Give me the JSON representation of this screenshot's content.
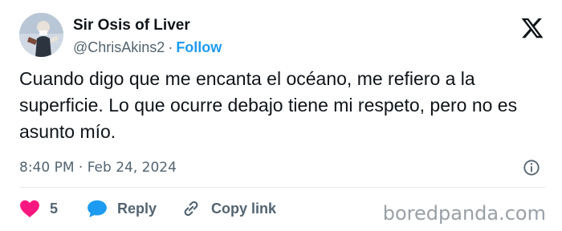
{
  "author": {
    "name": "Sir Osis of Liver",
    "handle": "@ChrisAkins2",
    "separator": "·",
    "follow_label": "Follow",
    "avatar_icon": "profile-avatar"
  },
  "platform": {
    "logo_icon": "x-logo-icon"
  },
  "tweet": {
    "text": "Cuando digo que me encanta el océano, me refiero a la superficie. Lo que ocurre debajo tiene mi respeto, pero no es asunto mío.",
    "timestamp": "8:40 PM · Feb 24, 2024"
  },
  "actions": {
    "like_count": "5",
    "reply_label": "Reply",
    "copy_link_label": "Copy link",
    "like_icon": "heart-icon",
    "reply_icon": "chat-bubble-icon",
    "copy_icon": "link-icon",
    "info_icon": "info-icon"
  },
  "colors": {
    "like": "#f91880",
    "reply": "#1d9bf0",
    "follow": "#1d9bf0",
    "muted_text": "#536471"
  },
  "watermark": {
    "text": "boredpanda.com"
  }
}
